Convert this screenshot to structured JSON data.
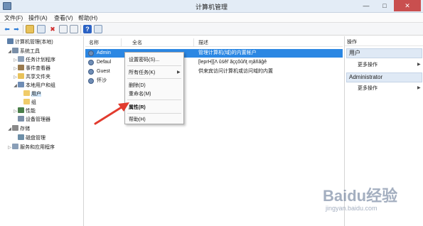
{
  "window": {
    "title": "计算机管理",
    "controls": {
      "minimize": "—",
      "maximize": "□",
      "close": "✕"
    }
  },
  "menubar": [
    {
      "label": "文件(F)"
    },
    {
      "label": "操作(A)"
    },
    {
      "label": "查看(V)"
    },
    {
      "label": "帮助(H)"
    }
  ],
  "toolbar": [
    {
      "icon": "back-arrow-icon",
      "glyph": "⬅"
    },
    {
      "icon": "forward-arrow-icon",
      "glyph": "➡"
    },
    {
      "icon": "folder-up-icon",
      "glyph": ""
    },
    {
      "icon": "console-tree-icon",
      "glyph": ""
    },
    {
      "icon": "delete-icon",
      "glyph": "✖"
    },
    {
      "icon": "properties-icon",
      "glyph": ""
    },
    {
      "icon": "export-icon",
      "glyph": ""
    },
    {
      "icon": "help-icon",
      "glyph": "?"
    },
    {
      "icon": "view-icon",
      "glyph": ""
    }
  ],
  "tree": [
    {
      "label": "计算机管理(本地)",
      "expander": "",
      "color": "#5d7fa8"
    },
    {
      "label": "系统工具",
      "expander": "◢",
      "color": "#7a8fa8"
    },
    {
      "label": "任务计划程序",
      "expander": "▷",
      "color": "#8a9fb8"
    },
    {
      "label": "事件查看器",
      "expander": "▷",
      "color": "#9a7b4f"
    },
    {
      "label": "共享文件夹",
      "expander": "▷",
      "color": "#e8c25a"
    },
    {
      "label": "本地用户和组",
      "expander": "◢",
      "color": "#6f8db5"
    },
    {
      "label": "用户",
      "expander": "",
      "color": "#f0cc6a",
      "selected": true
    },
    {
      "label": "组",
      "expander": "",
      "color": "#f0cc6a"
    },
    {
      "label": "性能",
      "expander": "▷",
      "color": "#4a7f4a"
    },
    {
      "label": "设备管理器",
      "expander": "",
      "color": "#7b8fa8"
    },
    {
      "label": "存储",
      "expander": "◢",
      "color": "#8a8a8a"
    },
    {
      "label": "磁盘管理",
      "expander": "",
      "color": "#6d8fa8"
    },
    {
      "label": "服务和应用程序",
      "expander": "▷",
      "color": "#8a9fb8"
    }
  ],
  "list": {
    "columns": [
      "名称",
      "全名",
      "描述"
    ],
    "rows": [
      {
        "name": "Admin",
        "desc": "管理计算机(域)的内置帐户",
        "highlight": true
      },
      {
        "name": "Defaul",
        "desc": "[leprH][Λ ûśêř ãççôûñţ ɱãñãĝê"
      },
      {
        "name": "Guest",
        "desc": "供来宾访问计算机或访问域的内置"
      },
      {
        "name": "怀沙",
        "desc": ""
      }
    ]
  },
  "context_menu": {
    "items": [
      {
        "label": "设置密码(S)...",
        "bold": false
      },
      {
        "label": "所有任务(K)",
        "bold": false,
        "submenu": "▶"
      },
      {
        "label": "删除(D)",
        "bold": false
      },
      {
        "label": "重命名(M)",
        "bold": false
      },
      {
        "label": "属性(R)",
        "bold": true
      },
      {
        "label": "帮助(H)",
        "bold": false
      }
    ]
  },
  "actions": {
    "header": "操作",
    "sections": [
      {
        "title": "用户",
        "link": "更多操作",
        "caret": "▶"
      },
      {
        "title": "Administrator",
        "link": "更多操作",
        "caret": "▶"
      }
    ]
  },
  "watermark": {
    "main": "Baidu经验",
    "sub": "jingyan.baidu.com"
  },
  "colors": {
    "accent": "#2b87e3",
    "pointer_arrow": "#e23b2e",
    "close_button": "#c94f4f"
  }
}
